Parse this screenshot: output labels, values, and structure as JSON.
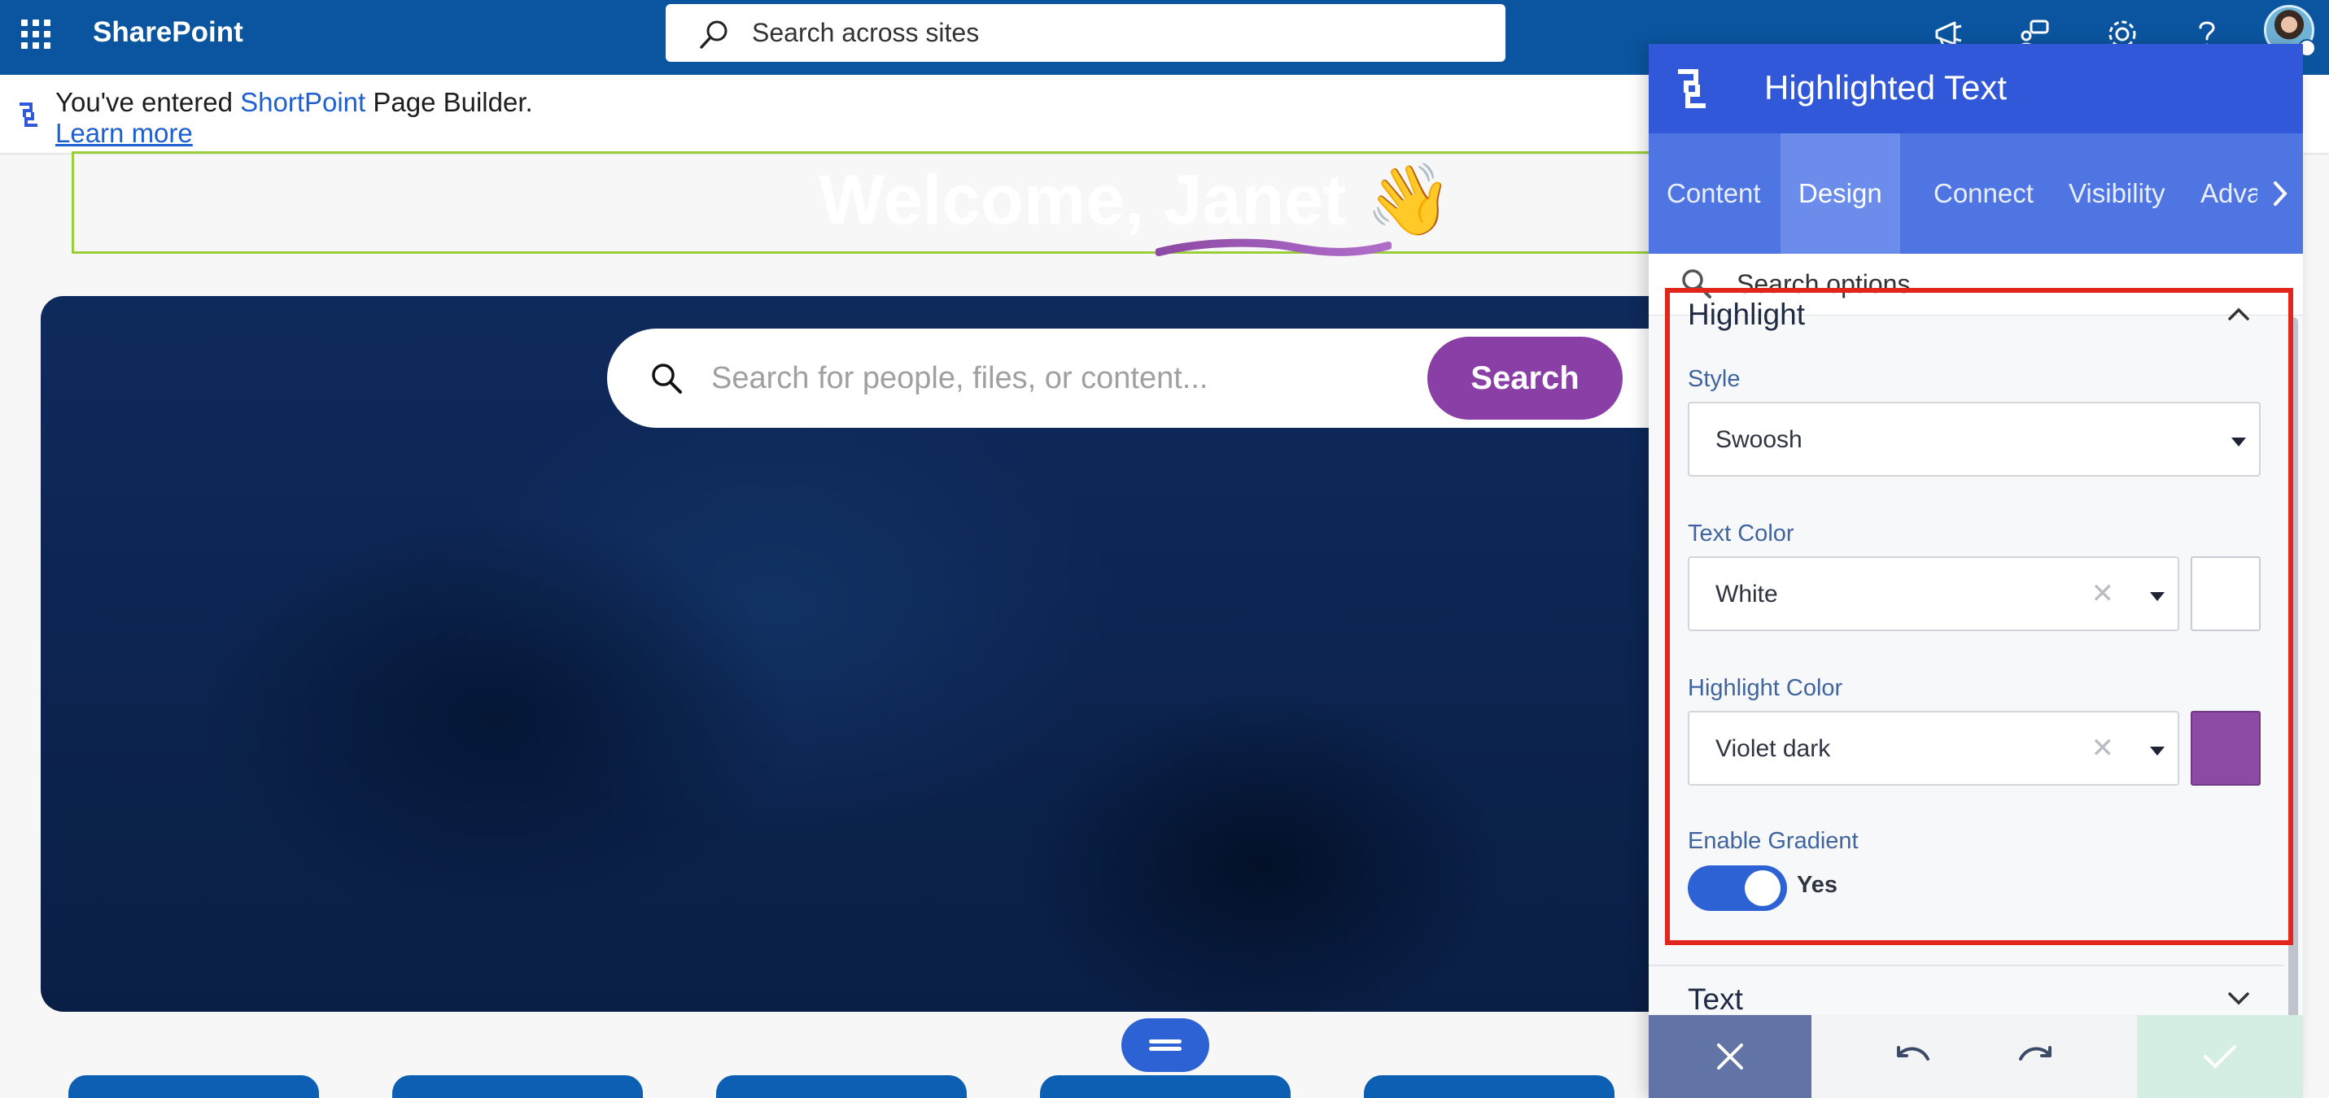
{
  "suite": {
    "app_name": "SharePoint",
    "search_placeholder": "Search across sites",
    "icons": [
      "waffle-icon",
      "megaphone-icon",
      "share-icon",
      "gear-icon",
      "help-icon",
      "avatar"
    ]
  },
  "notice": {
    "prefix": "You've entered ",
    "product": "ShortPoint",
    "suffix": " Page Builder.",
    "learn_more": "Learn more"
  },
  "hero": {
    "title_prefix": "Welcome, ",
    "title_name": "Janet",
    "title_emoji": "👋",
    "search_placeholder": "Search for people, files, or content...",
    "search_button": "Search"
  },
  "panel": {
    "title": "Highlighted Text",
    "tabs": [
      {
        "label": "Content",
        "active": false
      },
      {
        "label": "Design",
        "active": true
      },
      {
        "label": "Connect",
        "active": false
      },
      {
        "label": "Visibility",
        "active": false
      },
      {
        "label": "Advan",
        "active": false
      }
    ],
    "search_placeholder": "Search options",
    "highlight_section": {
      "title": "Highlight",
      "style_label": "Style",
      "style_value": "Swoosh",
      "text_color_label": "Text Color",
      "text_color_value": "White",
      "text_color_hex": "#ffffff",
      "highlight_color_label": "Highlight Color",
      "highlight_color_value": "Violet dark",
      "highlight_color_hex": "#8d4aa5",
      "gradient_label": "Enable Gradient",
      "gradient_value": "Yes",
      "gradient_enabled": true
    },
    "text_section": {
      "title": "Text"
    }
  },
  "colors": {
    "suite_bar": "#0b55a0",
    "panel_header": "#3158d8",
    "accent_violet": "#8a3fa7",
    "highlight_border": "#e3261c"
  }
}
